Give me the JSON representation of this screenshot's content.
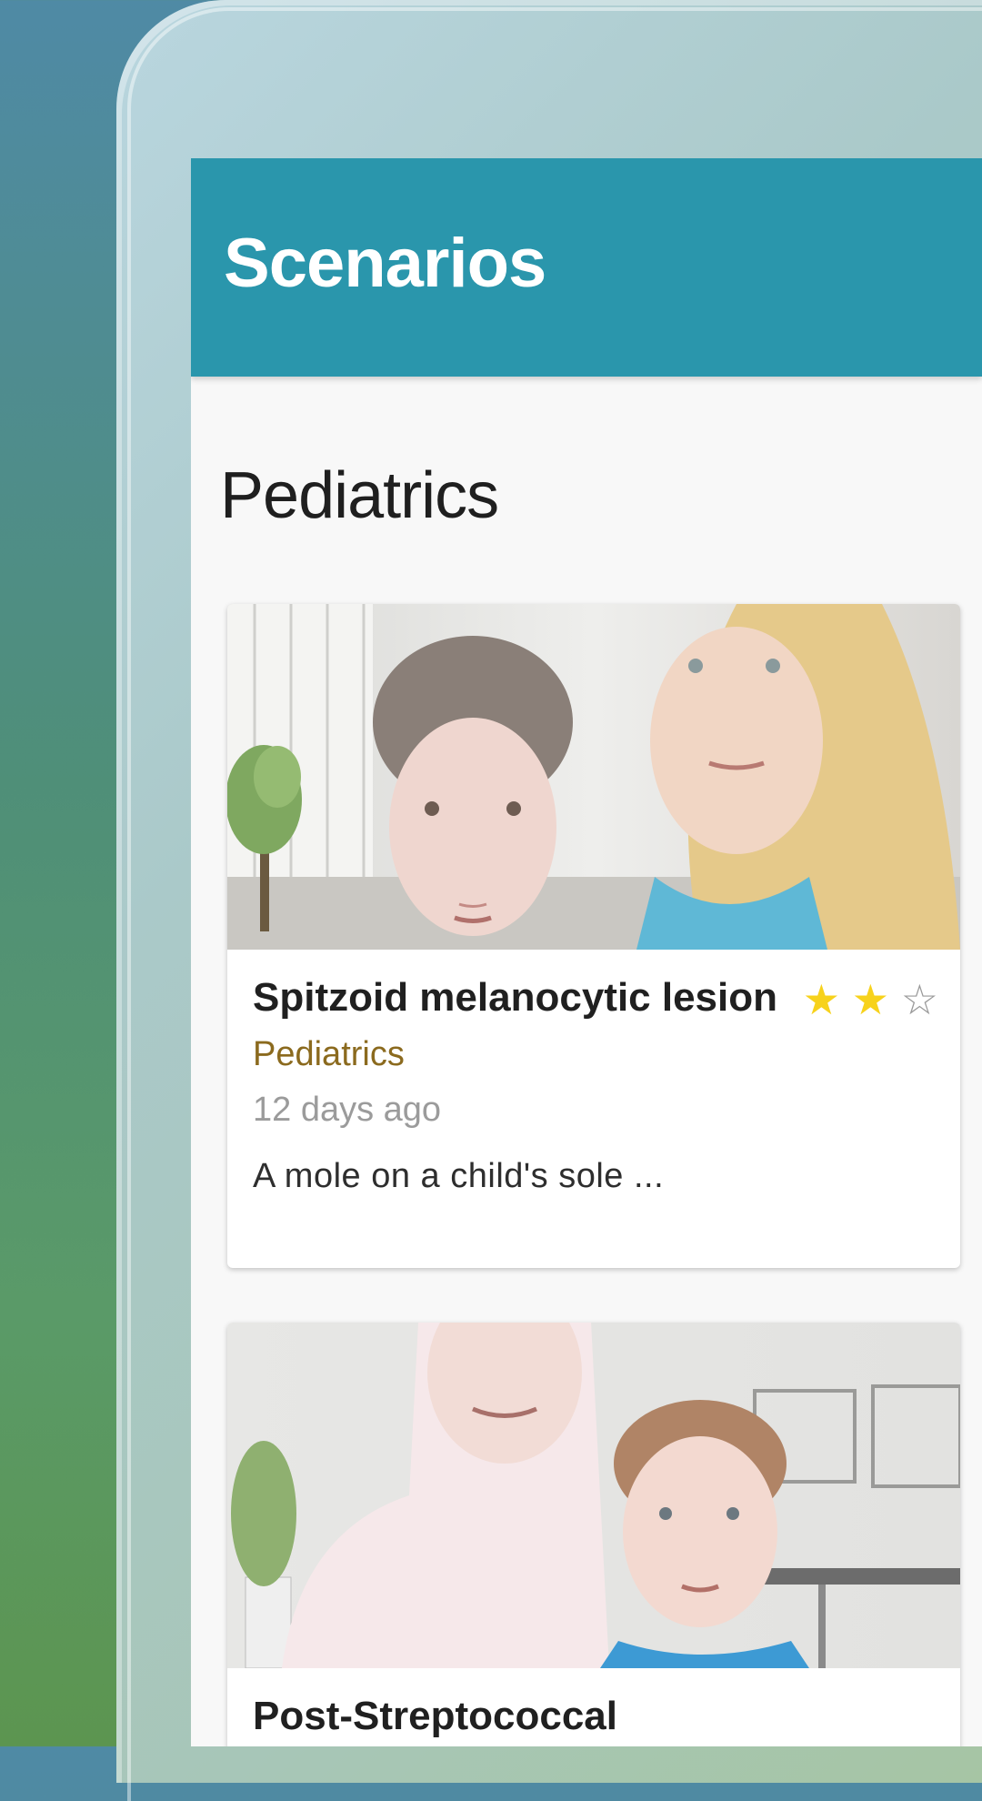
{
  "app": {
    "title": "Scenarios"
  },
  "section": {
    "title": "Pediatrics"
  },
  "cards": [
    {
      "title": "Spitzoid melanocytic lesion",
      "rating": 2,
      "rating_max": 3,
      "stars": {
        "filled": "★",
        "empty": "☆"
      },
      "category": "Pediatrics",
      "date": "12 days ago",
      "summary": "A mole on a child's sole ..."
    },
    {
      "title": "Post-Streptococcal"
    }
  ],
  "colors": {
    "header": "#2a96ac",
    "category": "#8b6a1e",
    "star": "#f7d21c",
    "background_top": "#4f8aa5",
    "background_bottom": "#5c9550"
  }
}
